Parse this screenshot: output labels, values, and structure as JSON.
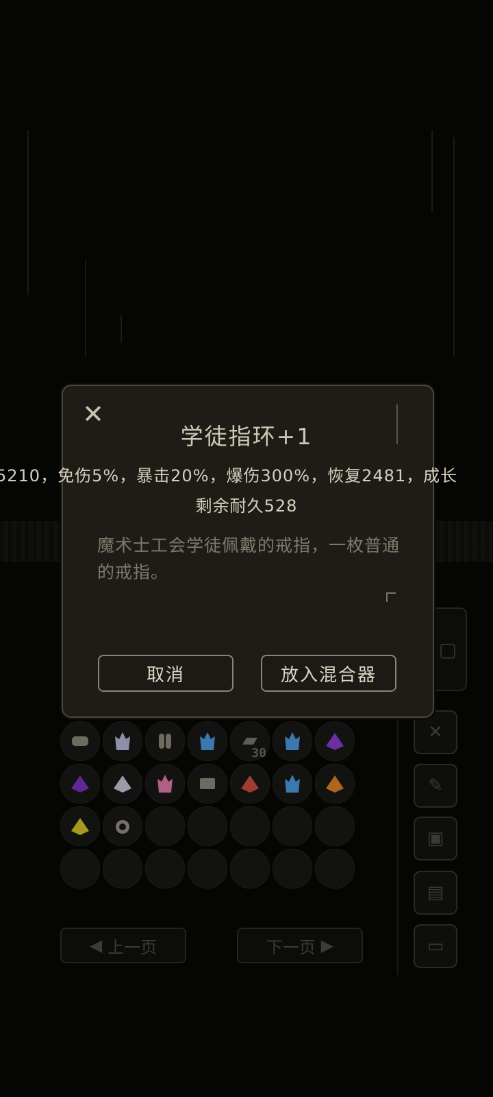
{
  "dialog": {
    "title": "学徒指环+1",
    "stats": "5210，免伤5%，暴击20%，爆伤300%，恢复2481，成长",
    "durability": "剩余耐久528",
    "description": "魔术士工会学徒佩戴的戒指，一枚普通的戒指。",
    "close_icon": "close-icon",
    "buttons": {
      "cancel": "取消",
      "put_in_mixer": "放入混合器"
    }
  },
  "inventory": {
    "items": [
      {
        "icon": "scroll-icon",
        "color": "#6e6a60"
      },
      {
        "icon": "crystal-icon",
        "color": "#8f8fa8"
      },
      {
        "icon": "chain-icon",
        "color": "#6e6a60"
      },
      {
        "icon": "crystal-icon",
        "color": "#3c78b0"
      },
      {
        "icon": "ingot-icon",
        "color": "#5f5c55",
        "quantity": "30"
      },
      {
        "icon": "crystal-icon",
        "color": "#3c78b0"
      },
      {
        "icon": "pyramid-icon",
        "color": "#6a2fa0"
      },
      {
        "icon": "pyramid-icon",
        "color": "#5d2890"
      },
      {
        "icon": "pyramid-icon",
        "color": "#9a9aa8"
      },
      {
        "icon": "crystal-icon",
        "color": "#b05f85"
      },
      {
        "icon": "card-icon",
        "color": "#6e6a60"
      },
      {
        "icon": "pyramid-icon",
        "color": "#a03c33"
      },
      {
        "icon": "crystal-icon",
        "color": "#3c78b0"
      },
      {
        "icon": "pyramid-icon",
        "color": "#b0651e"
      },
      {
        "icon": "pyramid-icon",
        "color": "#a89a1e"
      },
      {
        "icon": "ring-icon",
        "color": "#777268"
      }
    ],
    "prev_page": "上一页",
    "next_page": "下一页"
  }
}
